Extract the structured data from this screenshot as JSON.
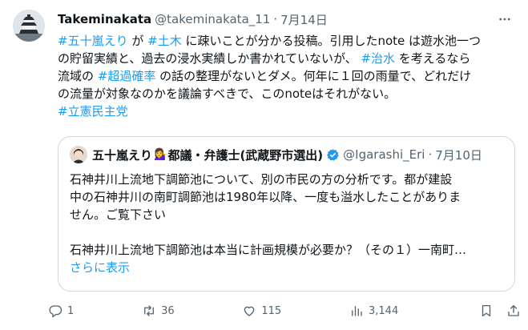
{
  "tweet": {
    "display_name": "Takeminakata",
    "handle": "@takeminakata_11",
    "separator": "·",
    "date": "7月14日",
    "more_icon": "more-horizontal-icon",
    "lines": [
      [
        {
          "t": "#五十嵐えり",
          "tag": true
        },
        {
          "t": " が ",
          "tag": false
        },
        {
          "t": "#土木",
          "tag": true
        },
        {
          "t": " に疎いことが分かる投稿。引用したnote は遊水池一つ",
          "tag": false
        }
      ],
      [
        {
          "t": "の貯留実績と、過去の浸水実績しか書かれていないが、 ",
          "tag": false
        },
        {
          "t": "#治水",
          "tag": true
        },
        {
          "t": " を考えるなら",
          "tag": false
        }
      ],
      [
        {
          "t": "流域の ",
          "tag": false
        },
        {
          "t": "#超過確率",
          "tag": true
        },
        {
          "t": " の話の整理がないとダメ。何年に１回の雨量で、どれだけ",
          "tag": false
        }
      ],
      [
        {
          "t": "の流量が対象なのかを議論すべきで、このnoteはそれがない。",
          "tag": false
        }
      ],
      [
        {
          "t": "#立憲民主党",
          "tag": true
        }
      ]
    ]
  },
  "quote": {
    "name": "五十嵐えり",
    "emoji": "💁‍♀️",
    "title": " 都議・弁護士(武蔵野市選出)",
    "handle": "@Igarashi_Eri",
    "separator": "·",
    "date": "7月10日",
    "lines": [
      "石神井川上流地下調節池について、別の市民の方の分析です。都が建設",
      "中の石神井川の南町調節池は1980年以降、一度も溢水したことがありま",
      "せん。ご覧下さい",
      "",
      "石神井川上流地下調節池は本当に計画規模が必要か？（その１）一南町…"
    ],
    "show_more": "さらに表示"
  },
  "actions": {
    "reply": {
      "icon": "reply-icon",
      "count": "1"
    },
    "retweet": {
      "icon": "retweet-icon",
      "count": "36"
    },
    "like": {
      "icon": "heart-icon",
      "count": "115"
    },
    "views": {
      "icon": "views-bar-chart-icon",
      "count": "3,144"
    },
    "bookmark": {
      "icon": "bookmark-icon"
    },
    "share": {
      "icon": "share-icon"
    }
  }
}
